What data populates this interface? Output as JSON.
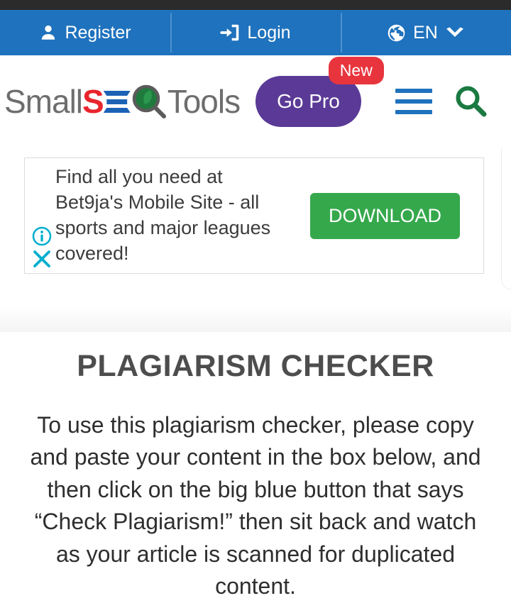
{
  "utility_bar": {
    "items": [
      {
        "label": "Register",
        "icon": "user-icon"
      },
      {
        "label": "Login",
        "icon": "sign-in-icon"
      },
      {
        "label": "EN",
        "icon": "globe-icon",
        "chevron": "chevron-down-icon"
      }
    ]
  },
  "header": {
    "logo": {
      "part1": "Small",
      "part2": "S",
      "part3": "E",
      "part4": "O",
      "part5": "Tools"
    },
    "go_pro_label": "Go Pro",
    "new_badge_label": "New",
    "menu_icon": "hamburger-menu-icon",
    "search_icon": "search-icon"
  },
  "ad": {
    "text": "Find all you need at Bet9ja's Mobile Site - all sports and major leagues covered!",
    "cta_label": "DOWNLOAD",
    "info_icon": "adchoices-info-icon",
    "close_icon": "close-icon"
  },
  "main": {
    "title": "PLAGIARISM CHECKER",
    "description": "To use this plagiarism checker, please copy and paste your content in the box below, and then click on the big blue button that says “Check Plagiarism!” then sit back and watch as your article is scanned for duplicated content."
  },
  "colors": {
    "top_strip": "#2b2b2b",
    "utility_bar": "#1f72bd",
    "go_pro": "#5a3a96",
    "new_badge": "#e8353d",
    "ad_cta": "#35a84c",
    "search_icon": "#1a7a42",
    "logo_red": "#e8242c",
    "logo_blue": "#1b62b5",
    "adchoices": "#00aecd"
  }
}
